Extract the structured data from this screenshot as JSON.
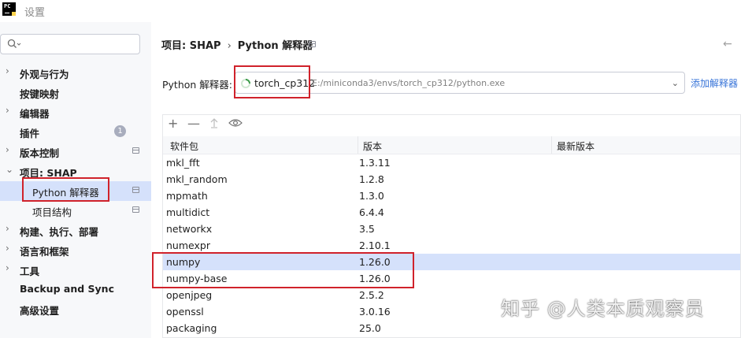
{
  "window": {
    "title": "设置",
    "logo_text": "PC"
  },
  "sidebar": {
    "search_placeholder": "",
    "items": [
      {
        "label": "外观与行为",
        "arrow": "›",
        "level": 0
      },
      {
        "label": "按键映射",
        "arrow": "",
        "level": 0
      },
      {
        "label": "编辑器",
        "arrow": "›",
        "level": 0
      },
      {
        "label": "插件",
        "arrow": "",
        "level": 0,
        "badge": "1"
      },
      {
        "label": "版本控制",
        "arrow": "›",
        "level": 0
      },
      {
        "label": "项目: SHAP",
        "arrow": "⌄",
        "level": 0
      },
      {
        "label": "Python 解释器",
        "arrow": "",
        "level": 1,
        "selected": true
      },
      {
        "label": "项目结构",
        "arrow": "",
        "level": 1
      },
      {
        "label": "构建、执行、部署",
        "arrow": "›",
        "level": 0
      },
      {
        "label": "语言和框架",
        "arrow": "›",
        "level": 0
      },
      {
        "label": "工具",
        "arrow": "›",
        "level": 0
      },
      {
        "label": "Backup and Sync",
        "arrow": "",
        "level": 0
      },
      {
        "label": "高级设置",
        "arrow": "",
        "level": 0
      }
    ]
  },
  "breadcrumb": {
    "project": "项目: SHAP",
    "separator": "›",
    "page": "Python 解释器"
  },
  "interpreter": {
    "label": "Python 解释器:",
    "name": "torch_cp312",
    "path": "E:/miniconda3/envs/torch_cp312/python.exe",
    "add_link": "添加解释器"
  },
  "packages": {
    "columns": [
      "软件包",
      "版本",
      "最新版本"
    ],
    "rows": [
      {
        "name": "mkl_fft",
        "version": "1.3.11",
        "latest": ""
      },
      {
        "name": "mkl_random",
        "version": "1.2.8",
        "latest": ""
      },
      {
        "name": "mpmath",
        "version": "1.3.0",
        "latest": ""
      },
      {
        "name": "multidict",
        "version": "6.4.4",
        "latest": ""
      },
      {
        "name": "networkx",
        "version": "3.5",
        "latest": ""
      },
      {
        "name": "numexpr",
        "version": "2.10.1",
        "latest": ""
      },
      {
        "name": "numpy",
        "version": "1.26.0",
        "latest": "",
        "selected": true
      },
      {
        "name": "numpy-base",
        "version": "1.26.0",
        "latest": ""
      },
      {
        "name": "openjpeg",
        "version": "2.5.2",
        "latest": ""
      },
      {
        "name": "openssl",
        "version": "3.0.16",
        "latest": ""
      },
      {
        "name": "packaging",
        "version": "25.0",
        "latest": ""
      }
    ]
  },
  "watermark": "知乎 @人类本质观察员",
  "colors": {
    "accent": "#3874d8",
    "highlight_box": "#d0222b",
    "selection": "#d5e1fb",
    "sidebar_bg": "#f7f8fa"
  }
}
